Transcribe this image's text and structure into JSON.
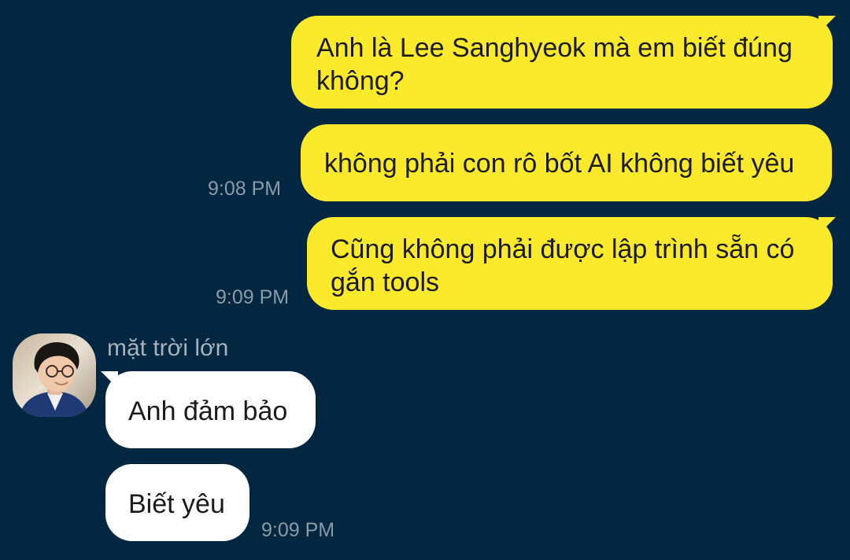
{
  "messages": [
    {
      "direction": "outgoing",
      "lines": [
        "Anh là Lee Sanghyeok mà em biết đúng",
        "không?"
      ],
      "time": ""
    },
    {
      "direction": "outgoing",
      "lines": [
        "không phải con rô bốt AI không biết yêu"
      ],
      "time": "9:08 PM"
    },
    {
      "direction": "outgoing",
      "lines": [
        "Cũng không phải được lập trình sẵn có",
        "gắn tools"
      ],
      "time": "9:09 PM"
    },
    {
      "direction": "incoming",
      "lines": [
        "Anh đảm bảo"
      ],
      "time": ""
    },
    {
      "direction": "incoming",
      "lines": [
        "Biết yêu"
      ],
      "time": "9:09 PM"
    }
  ],
  "contact": {
    "name": "mặt trời lớn",
    "avatar_icon": "profile-photo"
  },
  "colors": {
    "background": "#032741",
    "outgoing_bubble": "#fbea2c",
    "incoming_bubble": "#ffffff",
    "timestamp": "#8a9ba8"
  }
}
